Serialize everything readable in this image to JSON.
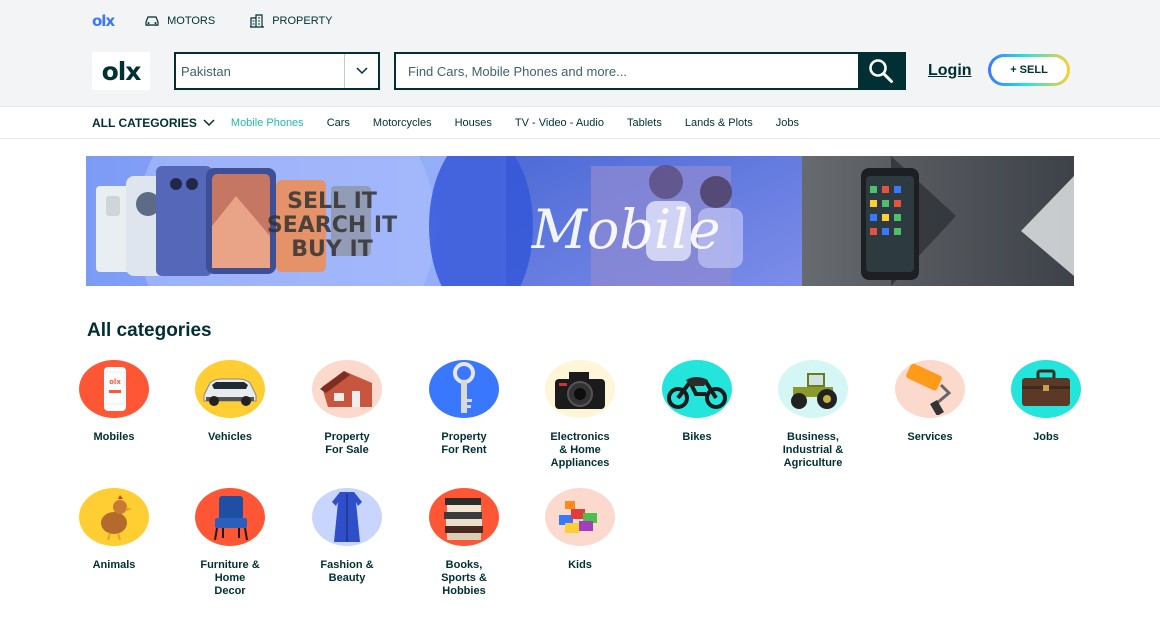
{
  "top_links": {
    "brand": "olx",
    "motors": "MOTORS",
    "property": "PROPERTY"
  },
  "header": {
    "logo": "olx",
    "location": "Pakistan",
    "search_placeholder": "Find Cars, Mobile Phones and more...",
    "login": "Login",
    "sell": "+ SELL"
  },
  "category_bar": {
    "all_label": "ALL CATEGORIES",
    "links": [
      "Mobile Phones",
      "Cars",
      "Motorcycles",
      "Houses",
      "TV - Video - Audio",
      "Tablets",
      "Lands & Plots",
      "Jobs"
    ]
  },
  "banner": {
    "text_lines": [
      "SELL IT",
      "SEARCH IT",
      "BUY IT"
    ],
    "script_text": "Mobile"
  },
  "section_title": "All categories",
  "categories": [
    {
      "label": "Mobiles",
      "icon": "mobile-phone-icon",
      "bg": "#ff5636"
    },
    {
      "label": "Vehicles",
      "icon": "car-icon",
      "bg": "#ffce32"
    },
    {
      "label": "Property\nFor Sale",
      "icon": "house-icon",
      "bg": "#fcd9cd"
    },
    {
      "label": "Property\nFor Rent",
      "icon": "key-icon",
      "bg": "#3a77ff"
    },
    {
      "label": "Electronics\n& Home\nAppliances",
      "icon": "camera-icon",
      "bg": "#fff6d9"
    },
    {
      "label": "Bikes",
      "icon": "motorbike-icon",
      "bg": "#23e5db"
    },
    {
      "label": "Business,\nIndustrial &\nAgriculture",
      "icon": "tractor-icon",
      "bg": "#d4f7f5"
    },
    {
      "label": "Services",
      "icon": "paint-roller-icon",
      "bg": "#fcd9cd"
    },
    {
      "label": "Jobs",
      "icon": "briefcase-icon",
      "bg": "#23e5db"
    },
    {
      "label": "Animals",
      "icon": "chicken-icon",
      "bg": "#ffce32"
    },
    {
      "label": "Furniture &\nHome\nDecor",
      "icon": "chair-icon",
      "bg": "#ff5636"
    },
    {
      "label": "Fashion &\nBeauty",
      "icon": "dress-icon",
      "bg": "#c8d6ff"
    },
    {
      "label": "Books,\nSports &\nHobbies",
      "icon": "books-icon",
      "bg": "#ff5636"
    },
    {
      "label": "Kids",
      "icon": "toy-blocks-icon",
      "bg": "#fcd9cd"
    }
  ],
  "colors": {
    "primary": "#002f34",
    "accent_teal": "#23e5db",
    "accent_blue": "#3a77ff",
    "accent_yellow": "#ffce32",
    "background": "#f2f4f5"
  }
}
